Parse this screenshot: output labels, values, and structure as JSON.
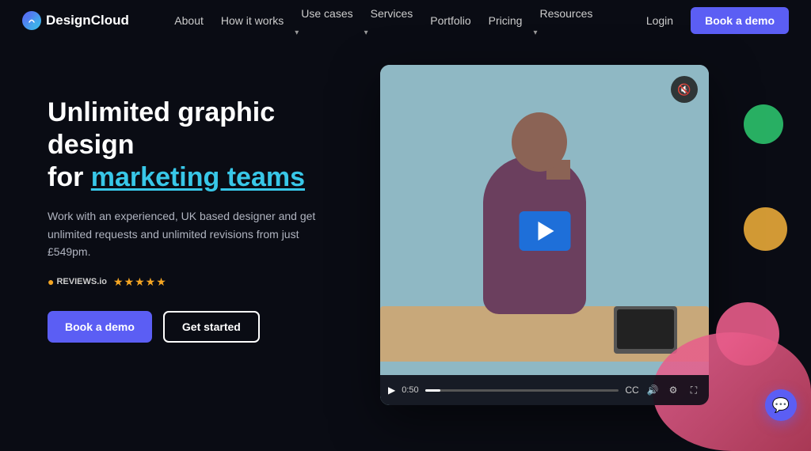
{
  "logo": {
    "text_design": "Design",
    "text_cloud": "Cloud"
  },
  "nav": {
    "links": [
      {
        "label": "About",
        "hasDropdown": false
      },
      {
        "label": "How it works",
        "hasDropdown": false
      },
      {
        "label": "Use cases",
        "hasDropdown": true
      },
      {
        "label": "Services",
        "hasDropdown": true
      },
      {
        "label": "Portfolio",
        "hasDropdown": false
      },
      {
        "label": "Pricing",
        "hasDropdown": false
      },
      {
        "label": "Resources",
        "hasDropdown": true
      }
    ],
    "login": "Login",
    "book_demo": "Book a demo"
  },
  "hero": {
    "title_line1": "Unlimited graphic design",
    "title_line2": "for ",
    "title_highlight": "marketing teams",
    "description": "Work with an experienced, UK based designer and get unlimited requests and unlimited revisions from just £549pm.",
    "reviews_text": "REVIEWS.io",
    "stars": "★★★★★",
    "cta_primary": "Book a demo",
    "cta_secondary": "Get started"
  },
  "video": {
    "time_current": "0:50",
    "mute_icon": "🔇",
    "play_icon": "▶"
  },
  "chat": {
    "icon": "💬"
  }
}
